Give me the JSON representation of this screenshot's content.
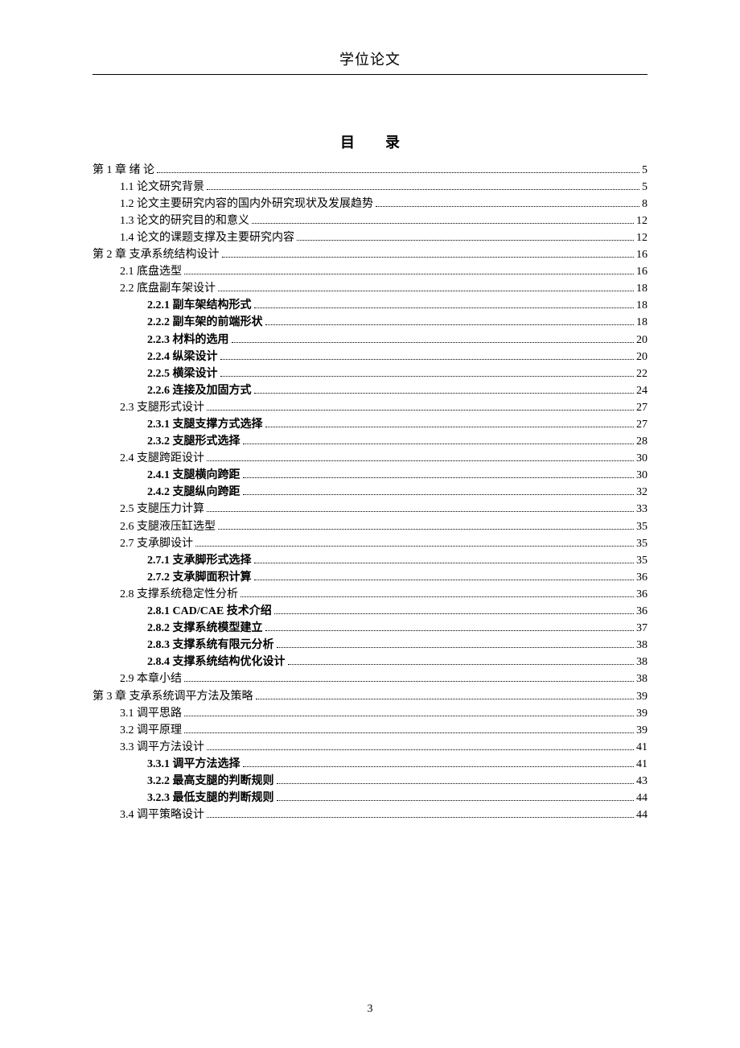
{
  "running_head": "学位论文",
  "toc_title": "目录",
  "page_number": "3",
  "toc": [
    {
      "level": 0,
      "bold": false,
      "label": "第 1 章  绪  论",
      "page": "5"
    },
    {
      "level": 1,
      "bold": false,
      "label": "1.1  论文研究背景",
      "page": "5"
    },
    {
      "level": 1,
      "bold": false,
      "label": "1.2  论文主要研究内容的国内外研究现状及发展趋势",
      "page": "8"
    },
    {
      "level": 1,
      "bold": false,
      "label": "1.3  论文的研究目的和意义",
      "page": "12"
    },
    {
      "level": 1,
      "bold": false,
      "label": "1.4  论文的课题支撑及主要研究内容",
      "page": "12"
    },
    {
      "level": 0,
      "bold": false,
      "label": "第 2 章  支承系统结构设计",
      "page": "16"
    },
    {
      "level": 1,
      "bold": false,
      "label": "2.1 底盘选型",
      "page": "16"
    },
    {
      "level": 1,
      "bold": false,
      "label": "2.2 底盘副车架设计",
      "page": "18"
    },
    {
      "level": 2,
      "bold": true,
      "label": "2.2.1 副车架结构形式",
      "page": "18"
    },
    {
      "level": 2,
      "bold": true,
      "label": "2.2.2 副车架的前端形状",
      "page": "18"
    },
    {
      "level": 2,
      "bold": true,
      "label": "2.2.3 材料的选用",
      "page": "20"
    },
    {
      "level": 2,
      "bold": true,
      "label": "2.2.4 纵梁设计",
      "page": "20"
    },
    {
      "level": 2,
      "bold": true,
      "label": "2.2.5 横梁设计",
      "page": "22"
    },
    {
      "level": 2,
      "bold": true,
      "label": "2.2.6 连接及加固方式",
      "page": "24"
    },
    {
      "level": 1,
      "bold": false,
      "label": "2.3 支腿形式设计",
      "page": "27"
    },
    {
      "level": 2,
      "bold": true,
      "label": "2.3.1 支腿支撑方式选择",
      "page": "27"
    },
    {
      "level": 2,
      "bold": true,
      "label": "2.3.2 支腿形式选择",
      "page": "28"
    },
    {
      "level": 1,
      "bold": false,
      "label": "2.4 支腿跨距设计",
      "page": "30"
    },
    {
      "level": 2,
      "bold": true,
      "label": "2.4.1 支腿横向跨距",
      "page": "30"
    },
    {
      "level": 2,
      "bold": true,
      "label": "2.4.2 支腿纵向跨距",
      "page": "32"
    },
    {
      "level": 1,
      "bold": false,
      "label": "2.5 支腿压力计算",
      "page": "33"
    },
    {
      "level": 1,
      "bold": false,
      "label": "2.6 支腿液压缸选型",
      "page": "35"
    },
    {
      "level": 1,
      "bold": false,
      "label": "2.7 支承脚设计",
      "page": "35"
    },
    {
      "level": 2,
      "bold": true,
      "label": "2.7.1 支承脚形式选择",
      "page": "35"
    },
    {
      "level": 2,
      "bold": true,
      "label": "2.7.2 支承脚面积计算",
      "page": "36"
    },
    {
      "level": 1,
      "bold": false,
      "label": "2.8 支撑系统稳定性分析",
      "page": "36"
    },
    {
      "level": 2,
      "bold": true,
      "label": "2.8.1 CAD/CAE 技术介绍",
      "page": "36"
    },
    {
      "level": 2,
      "bold": true,
      "label": "2.8.2  支撑系统模型建立",
      "page": "37"
    },
    {
      "level": 2,
      "bold": true,
      "label": "2.8.3  支撑系统有限元分析",
      "page": "38"
    },
    {
      "level": 2,
      "bold": true,
      "label": "2.8.4  支撑系统结构优化设计",
      "page": "38"
    },
    {
      "level": 1,
      "bold": false,
      "label": "2.9 本章小结",
      "page": "38"
    },
    {
      "level": 0,
      "bold": false,
      "label": "第 3 章  支承系统调平方法及策略",
      "page": "39"
    },
    {
      "level": 1,
      "bold": false,
      "label": "3.1 调平思路",
      "page": "39"
    },
    {
      "level": 1,
      "bold": false,
      "label": "3.2 调平原理",
      "page": "39"
    },
    {
      "level": 1,
      "bold": false,
      "label": "3.3 调平方法设计",
      "page": "41"
    },
    {
      "level": 2,
      "bold": true,
      "label": "3.3.1 调平方法选择",
      "page": "41"
    },
    {
      "level": 2,
      "bold": true,
      "label": "3.2.2  最高支腿的判断规则",
      "page": "43"
    },
    {
      "level": 2,
      "bold": true,
      "label": "3.2.3 最低支腿的判断规则",
      "page": "44"
    },
    {
      "level": 1,
      "bold": false,
      "label": "3.4 调平策略设计",
      "page": "44"
    }
  ]
}
